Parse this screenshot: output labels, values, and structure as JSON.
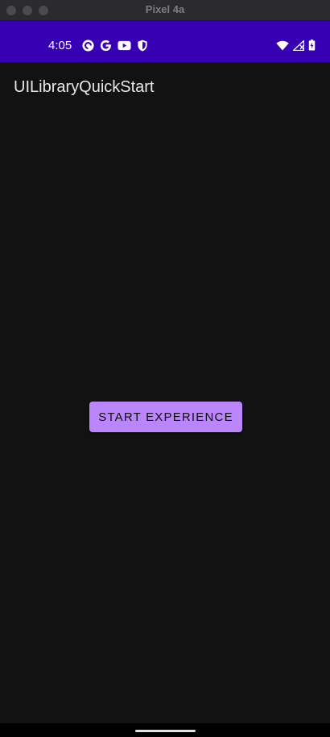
{
  "window": {
    "title": "Pixel 4a"
  },
  "status_bar": {
    "time": "4:05",
    "background_color": "#3700b3",
    "notification_icons": [
      "pocket-casts-icon",
      "google-icon",
      "youtube-icon",
      "shield-icon"
    ],
    "system_icons": [
      "wifi-icon",
      "cell-signal-icon",
      "battery-charging-icon"
    ]
  },
  "app_bar": {
    "title": "UILibraryQuickStart"
  },
  "main": {
    "start_button_label": "START EXPERIENCE",
    "button_color": "#bb86fc",
    "background_color": "#121212"
  }
}
